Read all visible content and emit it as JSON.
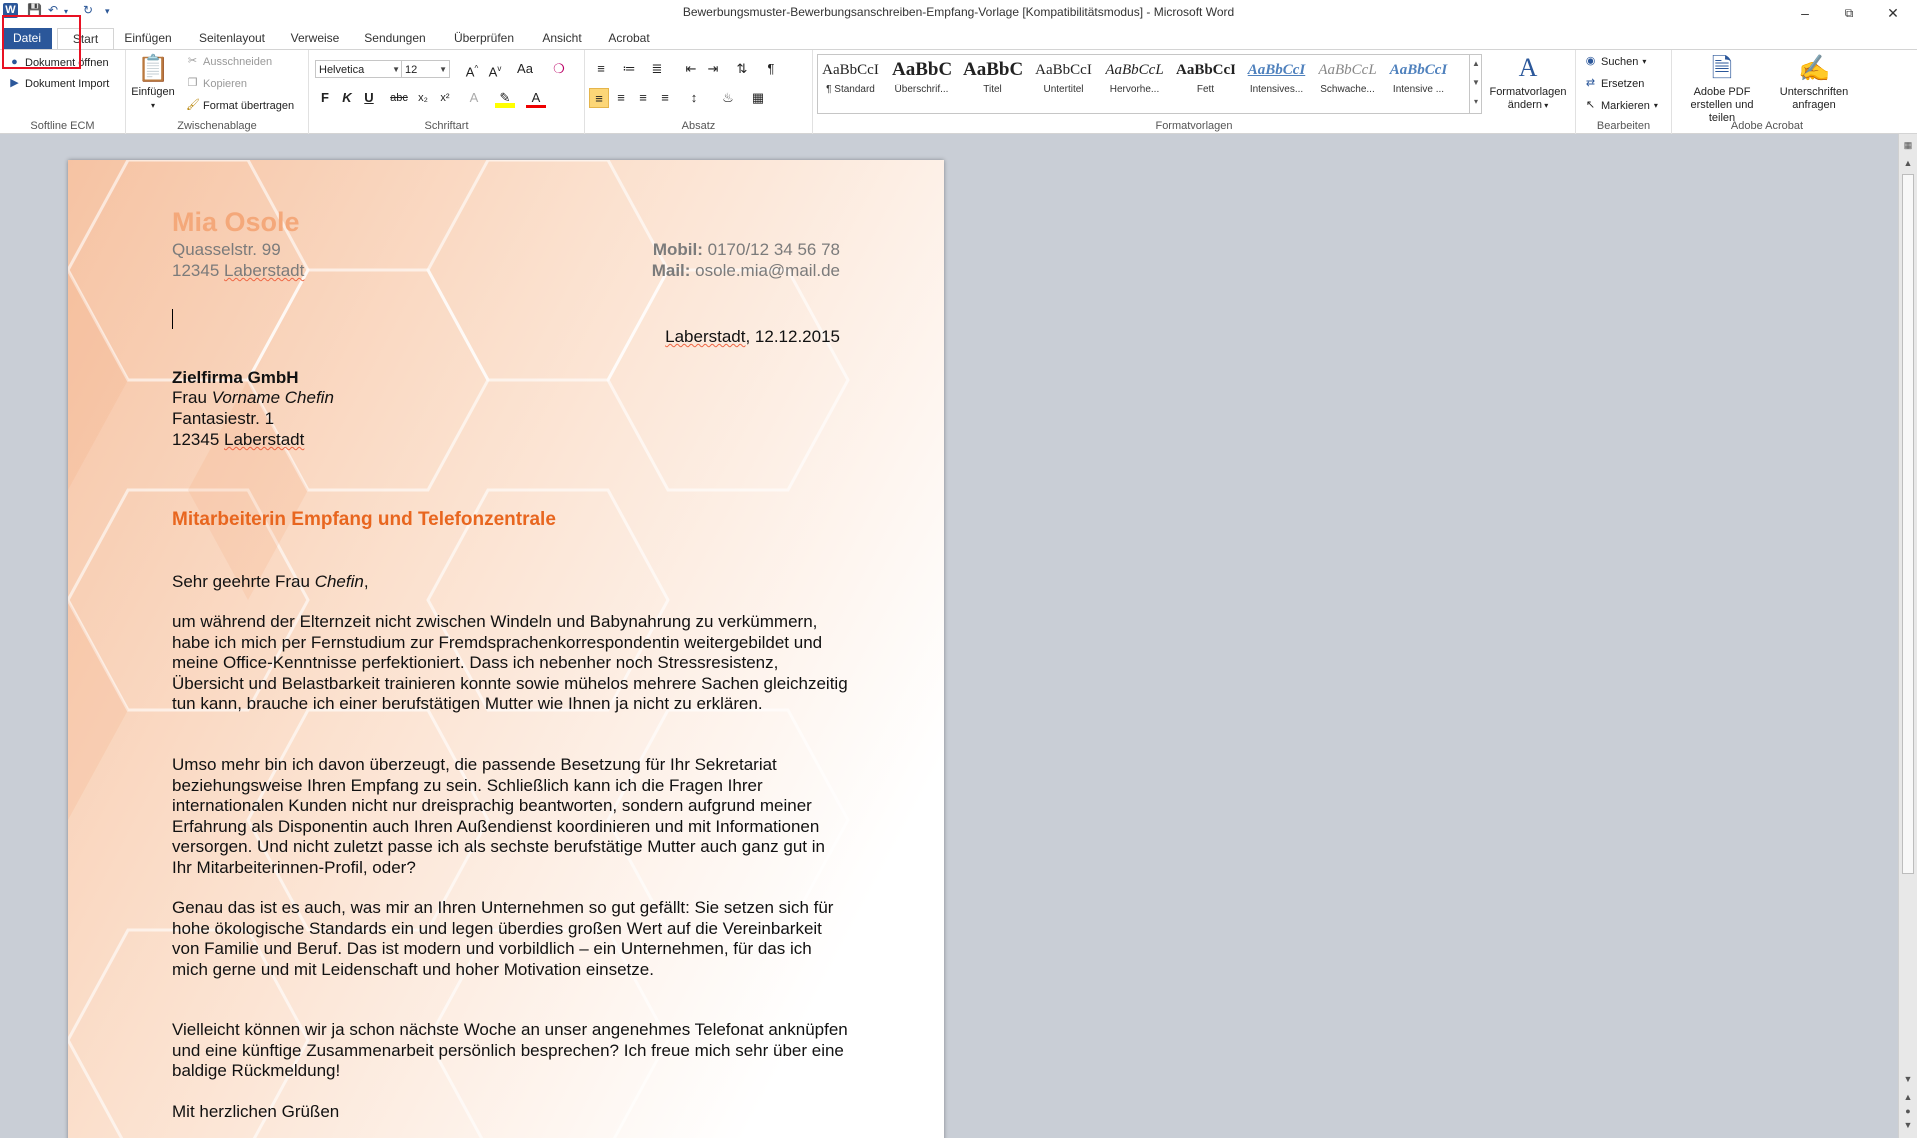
{
  "window": {
    "title": "Bewerbungsmuster-Bewerbungsanschreiben-Empfang-Vorlage [Kompatibilitätsmodus] - Microsoft Word",
    "app_icon": "W"
  },
  "tabs": [
    {
      "label": "Datei"
    },
    {
      "label": "Start"
    },
    {
      "label": "Einfügen"
    },
    {
      "label": "Seitenlayout"
    },
    {
      "label": "Verweise"
    },
    {
      "label": "Sendungen"
    },
    {
      "label": "Überprüfen"
    },
    {
      "label": "Ansicht"
    },
    {
      "label": "Acrobat"
    }
  ],
  "ribbon": {
    "softline": {
      "open": "Dokument öffnen",
      "import": "Dokument Import",
      "label": "Softline ECM"
    },
    "clipboard": {
      "paste": "Einfügen",
      "cut": "Ausschneiden",
      "copy": "Kopieren",
      "format_painter": "Format übertragen",
      "label": "Zwischenablage"
    },
    "font": {
      "name": "Helvetica",
      "size": "12",
      "label": "Schriftart"
    },
    "paragraph": {
      "label": "Absatz"
    },
    "styles": {
      "label": "Formatvorlagen",
      "items": [
        {
          "sample": "AaBbCcI",
          "name": "¶ Standard"
        },
        {
          "sample": "AaBbC(",
          "name": "Überschrif..."
        },
        {
          "sample": "AaBbC(",
          "name": "Titel"
        },
        {
          "sample": "AaBbCcI",
          "name": "Untertitel"
        },
        {
          "sample": "AaBbCcL",
          "name": "Hervorhe..."
        },
        {
          "sample": "AaBbCcI",
          "name": "Fett"
        },
        {
          "sample": "AaBbCcI",
          "name": "Intensives..."
        },
        {
          "sample": "AaBbCcL",
          "name": "Schwache..."
        },
        {
          "sample": "AaBbCcI",
          "name": "Intensive ..."
        }
      ],
      "change_line1": "Formatvorlagen",
      "change_line2": "ändern"
    },
    "edit": {
      "find": "Suchen",
      "replace": "Ersetzen",
      "select": "Markieren",
      "label": "Bearbeiten"
    },
    "acrobat": {
      "pdf_line1": "Adobe PDF",
      "pdf_line2": "erstellen und teilen",
      "sign_line1": "Unterschriften",
      "sign_line2": "anfragen",
      "label": "Adobe Acrobat"
    }
  },
  "document": {
    "sender": {
      "name": "Mia Osole",
      "street": "Quasselstr. 99",
      "city_zip": "12345",
      "city": "Laberstadt",
      "mobile_label": "Mobil:",
      "mobile": "0170/12 34 56 78",
      "mail_label": "Mail:",
      "mail": "osole.mia@mail.de"
    },
    "date_place": "Laberstadt",
    "date": ", 12.12.2015",
    "recipient": {
      "company": "Zielfirma GmbH",
      "salutation_prefix": "Frau ",
      "contact": "Vorname Chefin",
      "street": "Fantasiestr. 1",
      "zip": "12345 ",
      "city": "Laberstadt"
    },
    "subject": "Mitarbeiterin Empfang und Telefonzentrale",
    "greeting_prefix": "Sehr geehrte Frau ",
    "greeting_name": "Chefin",
    "greeting_suffix": ",",
    "paragraphs": [
      "um während der Elternzeit nicht zwischen Windeln und Babynahrung zu verkümmern, habe ich mich per Fernstudium zur Fremdsprachenkorrespondentin weitergebildet und meine Office-Kenntnisse perfektioniert. Dass ich nebenher noch Stressresistenz, Übersicht und Belastbarkeit trainieren konnte sowie mühelos mehrere Sachen gleichzeitig tun kann, brauche ich einer berufstätigen Mutter wie Ihnen ja nicht zu erklären.",
      "Umso mehr bin ich davon überzeugt, die passende Besetzung für Ihr Sekretariat beziehungsweise Ihren Empfang zu sein. Schließlich kann ich die Fragen Ihrer internationalen Kunden nicht nur dreisprachig beantworten, sondern aufgrund meiner Erfahrung als Disponentin auch Ihren Außendienst koordinieren und mit Informationen versorgen. Und nicht zuletzt passe ich als sechste berufstätige Mutter auch ganz gut in Ihr Mitarbeiterinnen-Profil, oder?",
      "Genau das ist es auch, was mir an Ihren Unternehmen so gut gefällt: Sie setzen sich für hohe ökologische Standards ein und legen überdies großen Wert auf die Vereinbarkeit von Familie und Beruf. Das ist modern und vorbildlich – ein Unternehmen, für das ich mich gerne und mit Leidenschaft und hoher Motivation einsetze.",
      "Vielleicht können wir ja schon nächste Woche an unser angenehmes Telefonat anknüpfen und eine künftige Zusammenarbeit persönlich besprechen? Ich freue mich sehr über eine baldige Rückmeldung!"
    ],
    "closing": "Mit herzlichen Grüßen"
  }
}
